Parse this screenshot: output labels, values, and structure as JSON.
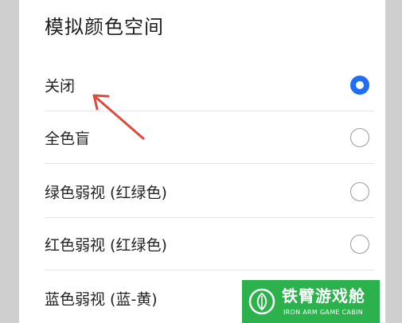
{
  "dialog": {
    "title": "模拟颜色空间",
    "options": [
      {
        "label": "关闭",
        "selected": true
      },
      {
        "label": "全色盲",
        "selected": false
      },
      {
        "label": "绿色弱视 (红绿色)",
        "selected": false
      },
      {
        "label": "红色弱视 (红绿色)",
        "selected": false
      },
      {
        "label": "蓝色弱视 (蓝-黄)",
        "selected": false
      }
    ]
  },
  "annotation": {
    "arrow_color": "#e04a3c"
  },
  "watermark": {
    "title": "铁臂游戏舱",
    "subtitle": "IRON ARM GAME CABIN",
    "color": "#2bb24c"
  },
  "colors": {
    "accent": "#1f6ef5"
  }
}
